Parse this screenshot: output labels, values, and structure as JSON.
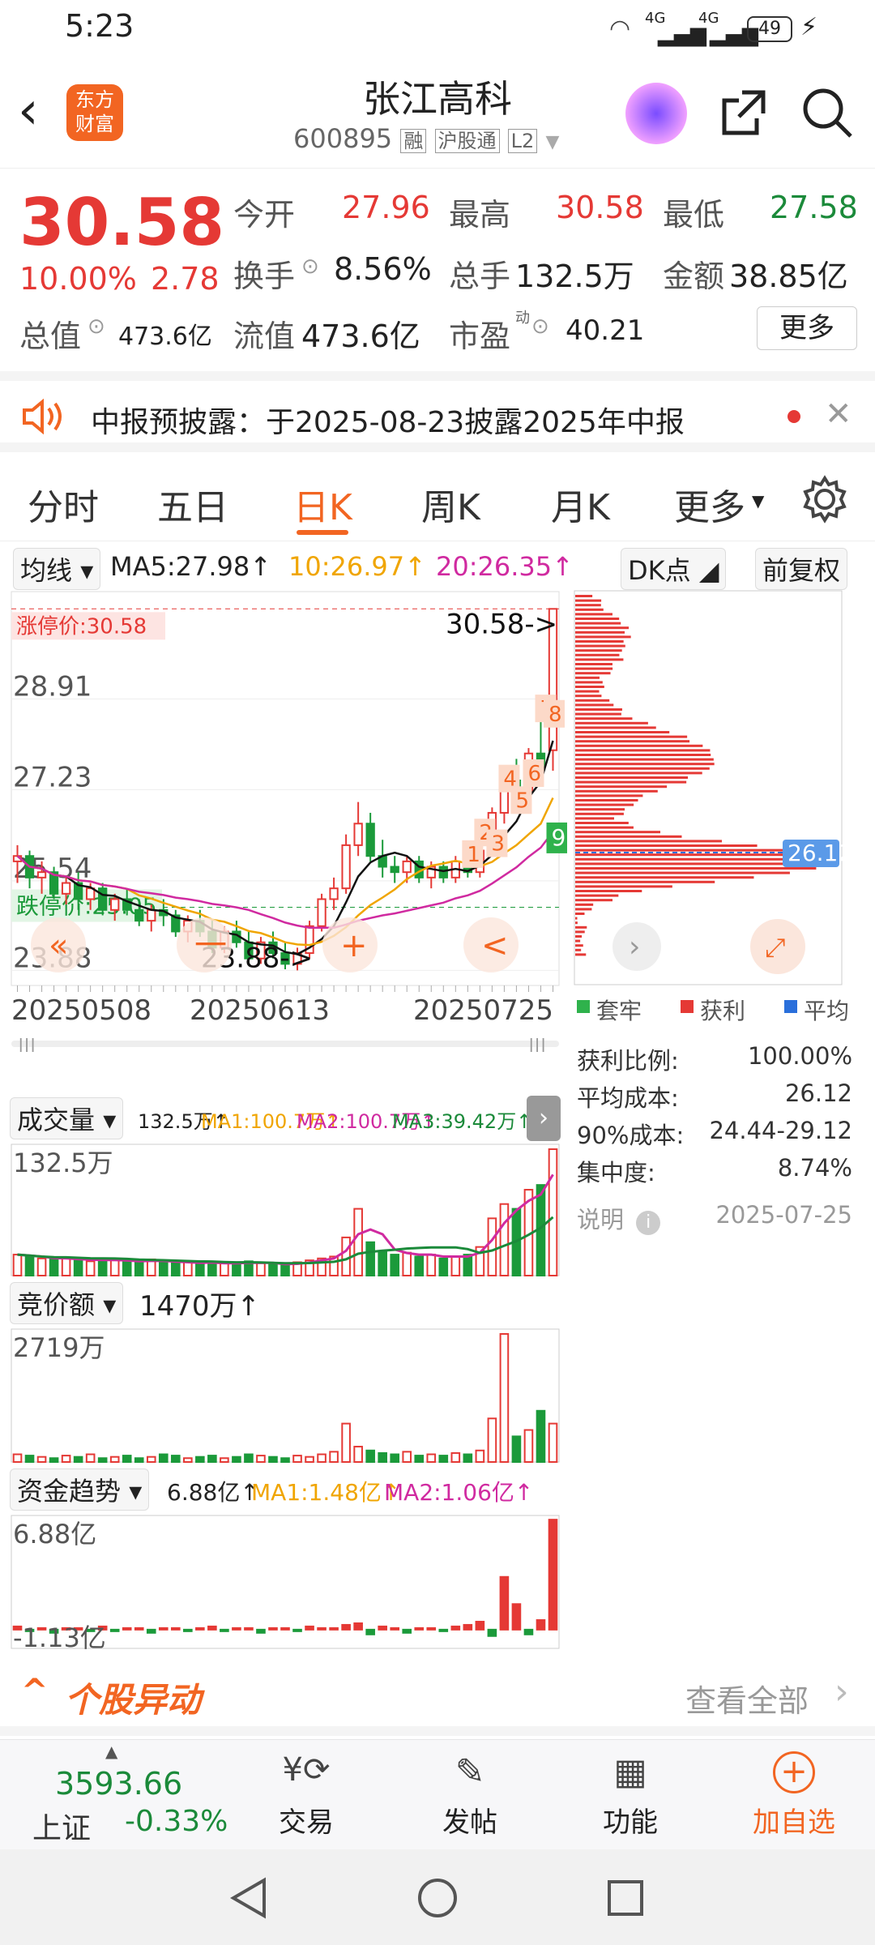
{
  "status": {
    "time": "5:23",
    "battery": "49",
    "net1": "4G",
    "net2": "4G"
  },
  "header": {
    "title": "张江高科",
    "code": "600895",
    "badge1": "融",
    "badge2": "沪股通",
    "badge3": "L2",
    "logo_line1": "东方",
    "logo_line2": "财富"
  },
  "quote": {
    "price": "30.58",
    "pct": "10.00%",
    "chg": "2.78",
    "open_label": "今开",
    "open": "27.96",
    "high_label": "最高",
    "high": "30.58",
    "low_label": "最低",
    "low": "27.58",
    "turnover_label": "换手",
    "turnover": "8.56%",
    "volume_label": "总手",
    "volume": "132.5万",
    "amount_label": "金额",
    "amount": "38.85亿",
    "mktcap_label": "总值",
    "mktcap": "473.6亿",
    "float_label": "流值",
    "float": "473.6亿",
    "pe_label": "市盈",
    "pe_sup": "动",
    "pe": "40.21",
    "more": "更多"
  },
  "notice": {
    "text": "中报预披露：于2025-08-23披露2025年中报"
  },
  "tabs": [
    "分时",
    "五日",
    "日K",
    "周K",
    "月K",
    "更多"
  ],
  "active_tab": 2,
  "ma_bar": {
    "selector": "均线",
    "ma5": "MA5:27.98↑",
    "ma10": "10:26.97↑",
    "ma20": "20:26.35↑",
    "dk": "DK点",
    "fq": "前复权"
  },
  "kline": {
    "y_labels": [
      "28.91",
      "27.23",
      "25.54",
      "23.88"
    ],
    "limit_up": "涨停价:30.58",
    "limit_down": "跌停价:25.05",
    "last_label": "30.58->",
    "low_label": "23.88->",
    "dates": [
      "20250508",
      "20250613",
      "20250725"
    ],
    "markers": [
      "1",
      "2",
      "3",
      "4",
      "5",
      "6",
      "7",
      "8"
    ],
    "marker_green": "9",
    "nav_prev": "«",
    "nav_minus": "一",
    "nav_plus": "+",
    "nav_back": "<",
    "chart_data": {
      "type": "candlestick",
      "ylim": [
        23.6,
        30.9
      ],
      "candles": [
        [
          25.9,
          26.2,
          25.5,
          26.0
        ],
        [
          26.0,
          26.1,
          25.4,
          25.6
        ],
        [
          25.6,
          25.9,
          25.3,
          25.7
        ],
        [
          25.7,
          25.8,
          25.2,
          25.3
        ],
        [
          25.3,
          25.6,
          25.1,
          25.5
        ],
        [
          25.5,
          25.7,
          25.0,
          25.2
        ],
        [
          25.2,
          25.5,
          25.0,
          25.4
        ],
        [
          25.4,
          25.5,
          24.9,
          25.0
        ],
        [
          25.0,
          25.3,
          24.8,
          25.2
        ],
        [
          25.2,
          25.4,
          24.9,
          25.0
        ],
        [
          25.0,
          25.2,
          24.7,
          24.8
        ],
        [
          24.8,
          25.1,
          24.6,
          25.0
        ],
        [
          25.0,
          25.2,
          24.7,
          24.9
        ],
        [
          24.9,
          25.0,
          24.5,
          24.6
        ],
        [
          24.6,
          24.9,
          24.4,
          24.8
        ],
        [
          24.8,
          25.0,
          24.5,
          24.6
        ],
        [
          24.6,
          24.8,
          24.2,
          24.3
        ],
        [
          24.3,
          24.7,
          24.2,
          24.6
        ],
        [
          24.6,
          24.8,
          24.3,
          24.4
        ],
        [
          24.4,
          24.6,
          24.0,
          24.1
        ],
        [
          24.1,
          24.5,
          24.0,
          24.4
        ],
        [
          24.4,
          24.6,
          24.1,
          24.2
        ],
        [
          24.2,
          24.4,
          23.9,
          24.0
        ],
        [
          24.0,
          24.3,
          23.88,
          24.2
        ],
        [
          24.2,
          24.8,
          24.1,
          24.7
        ],
        [
          24.7,
          25.3,
          24.6,
          25.2
        ],
        [
          25.2,
          25.6,
          25.0,
          25.4
        ],
        [
          25.4,
          26.4,
          25.3,
          26.2
        ],
        [
          26.2,
          27.0,
          26.0,
          26.6
        ],
        [
          26.6,
          26.8,
          25.9,
          26.0
        ],
        [
          26.0,
          26.3,
          25.6,
          25.8
        ],
        [
          25.8,
          26.0,
          25.5,
          25.7
        ],
        [
          25.7,
          26.0,
          25.5,
          25.9
        ],
        [
          25.9,
          26.0,
          25.5,
          25.6
        ],
        [
          25.6,
          25.9,
          25.4,
          25.8
        ],
        [
          25.8,
          25.9,
          25.5,
          25.6
        ],
        [
          25.6,
          26.0,
          25.5,
          25.9
        ],
        [
          25.9,
          26.1,
          25.6,
          25.7
        ],
        [
          25.7,
          26.2,
          25.6,
          26.1
        ],
        [
          26.1,
          26.9,
          26.0,
          26.8
        ],
        [
          26.8,
          27.6,
          26.6,
          27.4
        ],
        [
          27.4,
          27.8,
          27.0,
          27.2
        ],
        [
          27.2,
          28.0,
          27.1,
          27.9
        ],
        [
          27.9,
          28.5,
          27.5,
          27.6
        ],
        [
          27.96,
          30.58,
          27.58,
          30.58
        ]
      ],
      "volume": [
        22,
        20,
        18,
        17,
        19,
        16,
        15,
        18,
        16,
        14,
        15,
        17,
        14,
        13,
        15,
        12,
        14,
        13,
        12,
        15,
        13,
        12,
        11,
        14,
        16,
        18,
        20,
        40,
        70,
        35,
        25,
        22,
        24,
        20,
        22,
        18,
        20,
        22,
        30,
        60,
        75,
        70,
        90,
        95,
        132.5
      ],
      "volume_max_label": "132.5万",
      "auction": [
        6,
        5,
        4,
        3,
        5,
        4,
        6,
        3,
        4,
        5,
        3,
        4,
        6,
        5,
        3,
        4,
        5,
        3,
        4,
        6,
        5,
        4,
        3,
        5,
        4,
        6,
        8,
        30,
        12,
        9,
        7,
        6,
        8,
        5,
        6,
        5,
        7,
        6,
        9,
        34,
        100,
        20,
        25,
        40,
        30
      ],
      "auction_max_label": "2719万",
      "fund": [
        0.2,
        -0.1,
        0.1,
        -0.2,
        0.1,
        0.1,
        -0.1,
        0.2,
        -0.1,
        0.1,
        0.1,
        -0.2,
        0.1,
        0.1,
        -0.1,
        0.1,
        0.2,
        -0.1,
        0.1,
        0.1,
        -0.2,
        0.1,
        0.1,
        -0.1,
        0.2,
        0.1,
        0.1,
        0.3,
        0.4,
        -0.3,
        0.2,
        0.1,
        -0.2,
        0.1,
        0.1,
        -0.1,
        0.2,
        0.3,
        0.5,
        -0.4,
        3.3,
        1.6,
        -0.3,
        0.6,
        6.88
      ],
      "fund_max_label": "6.88亿",
      "fund_min_label": "-1.13亿"
    }
  },
  "chips": {
    "avg_label": "26.12",
    "legend": [
      "套牢",
      "获利",
      "平均"
    ],
    "colors": {
      "loss": "#2fb24c",
      "gain": "#e53935",
      "avg": "#2a6fdb"
    },
    "rows": [
      [
        "获利比例:",
        "100.00%"
      ],
      [
        "平均成本:",
        "26.12"
      ],
      [
        "90%成本:",
        "24.44-29.12"
      ],
      [
        "集中度:",
        "8.74%"
      ]
    ],
    "note": "说明",
    "date": "2025-07-25"
  },
  "vol_bar": {
    "selector": "成交量",
    "v": "132.5万↑",
    "ma1": "MA1:100.7万↑",
    "ma2": "MA2:100.7万↑",
    "ma3": "MA3:39.42万↑"
  },
  "auction_bar": {
    "selector": "竞价额",
    "v": "1470万↑"
  },
  "fund_bar": {
    "selector": "资金趋势",
    "v": "6.88亿↑",
    "ma1": "MA1:1.48亿↑",
    "ma2": "MA2:1.06亿↑"
  },
  "activity": {
    "title": "个股异动",
    "more": "查看全部"
  },
  "bottom": {
    "index_value": "3593.66",
    "index_name": "上证",
    "index_pct": "-0.33%",
    "trade": "交易",
    "post": "发帖",
    "func": "功能",
    "watch": "加自选"
  }
}
